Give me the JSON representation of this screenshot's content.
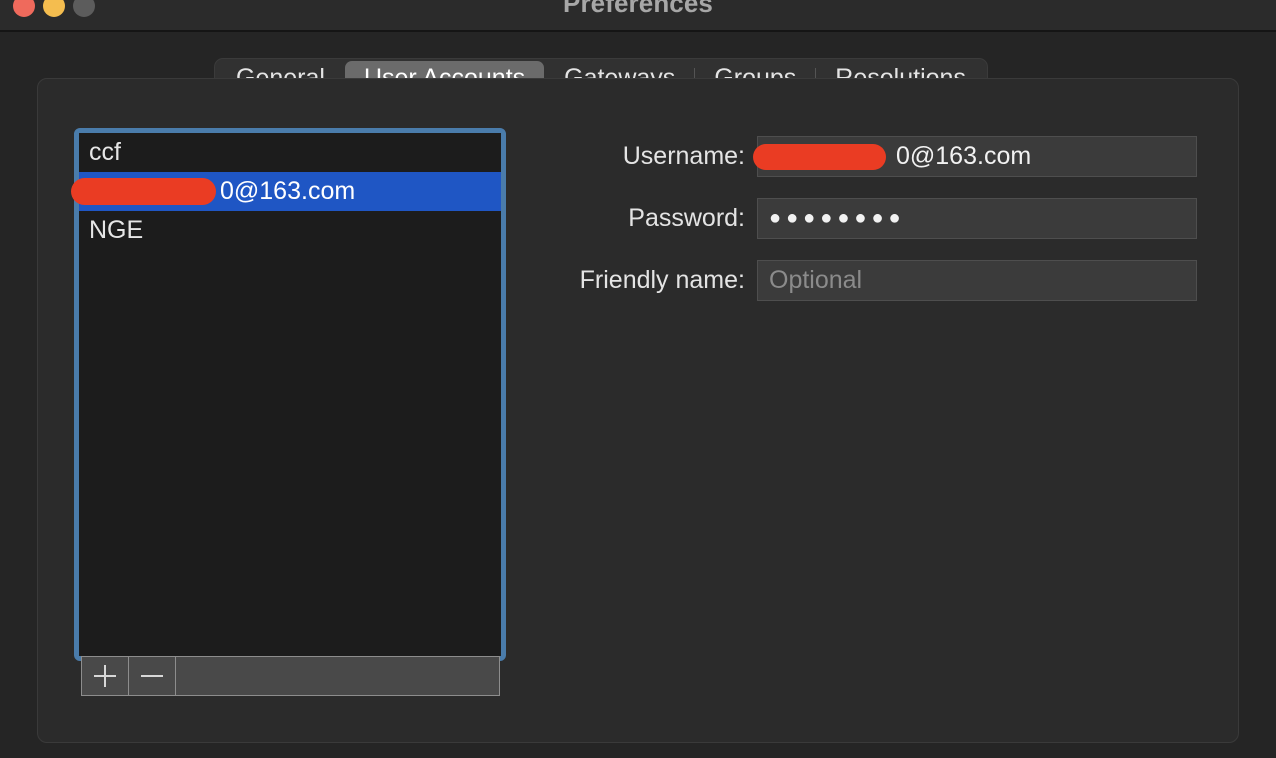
{
  "window": {
    "title": "Preferences",
    "traffic_lights": [
      {
        "name": "close",
        "color": "#ef6a5c"
      },
      {
        "name": "minimize",
        "color": "#f4bd4f"
      },
      {
        "name": "zoom",
        "color": "#5c5c5c"
      }
    ]
  },
  "tabs": [
    {
      "label": "General",
      "selected": false
    },
    {
      "label": "User Accounts",
      "selected": true
    },
    {
      "label": "Gateways",
      "selected": false
    },
    {
      "label": "Groups",
      "selected": false
    },
    {
      "label": "Resolutions",
      "selected": false
    }
  ],
  "account_list": {
    "items": [
      {
        "label": "ccf",
        "selected": false,
        "redacted": false
      },
      {
        "label": "0@163.com",
        "selected": true,
        "redacted": true
      },
      {
        "label": "NGE",
        "selected": false,
        "redacted": false
      }
    ],
    "selection_color": "#1f56c4",
    "focus_ring_color": "#4a7cab",
    "background_color": "#1c1c1c"
  },
  "list_toolbar": {
    "add_label": "+",
    "remove_label": "−"
  },
  "form": {
    "username": {
      "label": "Username:",
      "value": "0@163.com",
      "redacted": true
    },
    "password": {
      "label": "Password:",
      "value": "●●●●●●●●"
    },
    "friendly_name": {
      "label": "Friendly name:",
      "value": "",
      "placeholder": "Optional"
    }
  },
  "colors": {
    "window_background": "#252525",
    "panel_background": "#2b2b2b",
    "titlebar_background": "#2b2b2b",
    "tabbar_background": "#313131",
    "tab_selected_background": "#6b6b6b",
    "field_background": "#3b3b3b",
    "redaction": "#ea3c23",
    "text_primary": "#e4e4e4",
    "text_placeholder": "#8b8b8b"
  }
}
